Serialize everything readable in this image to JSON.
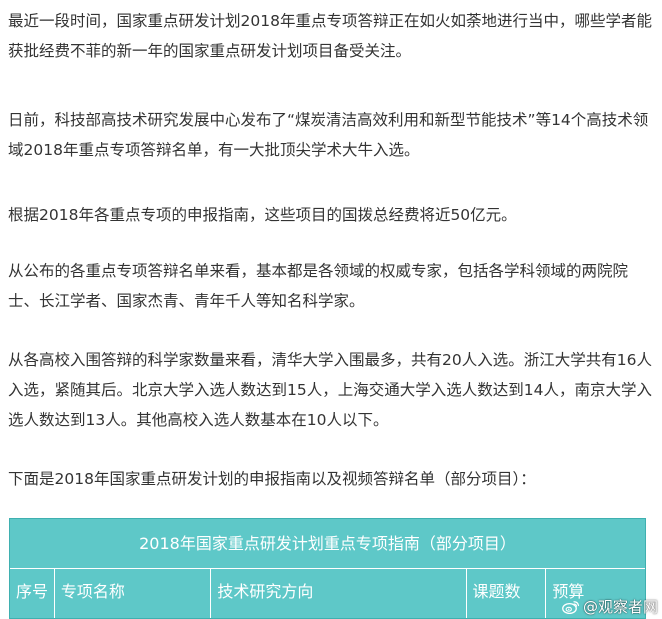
{
  "paragraphs": [
    "最近一段时间，国家重点研发计划2018年重点专项答辩正在如火如荼地进行当中，哪些学者能获批经费不菲的新一年的国家重点研发计划项目备受关注。",
    "日前，科技部高技术研究发展中心发布了“煤炭清洁高效利用和新型节能技术”等14个高技术领域2018年重点专项答辩名单，有一大批顶尖学术大牛入选。",
    "根据2018年各重点专项的申报指南，这些项目的国拨总经费将近50亿元。",
    "从公布的各重点专项答辩名单来看，基本都是各领域的权威专家，包括各学科领域的两院院士、长江学者、国家杰青、青年千人等知名科学家。",
    "从各高校入围答辩的科学家数量来看，清华大学入围最多，共有20人入选。浙江大学共有16人入选，紧随其后。北京大学入选人数达到15人，上海交通大学入选人数达到14人，南京大学入选人数达到13人。其他高校入选人数基本在10人以下。",
    "下面是2018年国家重点研发计划的申报指南以及视频答辩名单（部分项目）："
  ],
  "table": {
    "title": "2018年国家重点研发计划重点专项指南（部分项目）",
    "headers": [
      "序号",
      "专项名称",
      "技术研究方向",
      "课题数",
      "预算"
    ],
    "bg_color": "#5ec8c8"
  },
  "watermark": {
    "text": "@观察者网",
    "icon": "weibo-icon"
  }
}
